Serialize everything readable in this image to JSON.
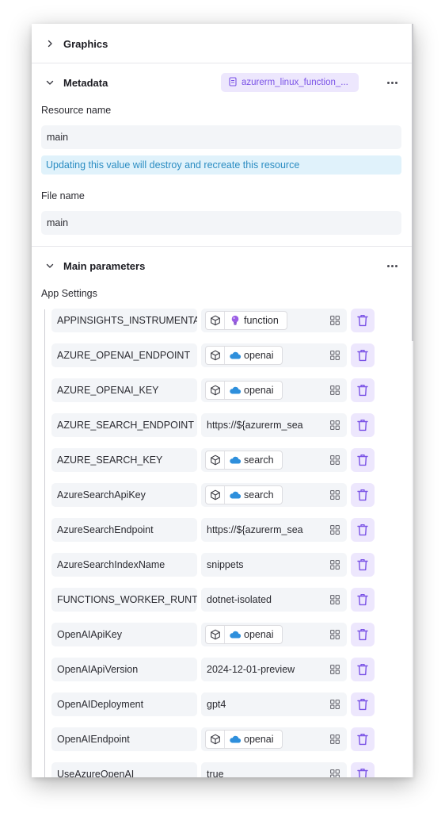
{
  "sections": {
    "graphics": {
      "title": "Graphics"
    },
    "metadata": {
      "title": "Metadata",
      "resource_badge": "azurerm_linux_function_...",
      "resource_name_label": "Resource name",
      "resource_name_value": "main",
      "info_message": "Updating this value will destroy and recreate this resource",
      "file_name_label": "File name",
      "file_name_value": "main"
    },
    "main_parameters": {
      "title": "Main parameters",
      "app_settings_label": "App Settings",
      "rows": [
        {
          "key": "APPINSIGHTS_INSTRUMENTAT",
          "type": "ref",
          "icon": "bulb-icon",
          "value": "function"
        },
        {
          "key": "AZURE_OPENAI_ENDPOINT",
          "type": "ref",
          "icon": "cloud-icon",
          "value": "openai"
        },
        {
          "key": "AZURE_OPENAI_KEY",
          "type": "ref",
          "icon": "cloud-icon",
          "value": "openai"
        },
        {
          "key": "AZURE_SEARCH_ENDPOINT",
          "type": "text",
          "value": "https://${azurerm_sea"
        },
        {
          "key": "AZURE_SEARCH_KEY",
          "type": "ref",
          "icon": "cloud-icon",
          "value": "search"
        },
        {
          "key": "AzureSearchApiKey",
          "type": "ref",
          "icon": "cloud-icon",
          "value": "search"
        },
        {
          "key": "AzureSearchEndpoint",
          "type": "text",
          "value": "https://${azurerm_sea"
        },
        {
          "key": "AzureSearchIndexName",
          "type": "text",
          "value": "snippets"
        },
        {
          "key": "FUNCTIONS_WORKER_RUNTIM",
          "type": "text",
          "value": "dotnet-isolated"
        },
        {
          "key": "OpenAIApiKey",
          "type": "ref",
          "icon": "cloud-icon",
          "value": "openai"
        },
        {
          "key": "OpenAIApiVersion",
          "type": "text",
          "value": "2024-12-01-preview"
        },
        {
          "key": "OpenAIDeployment",
          "type": "text",
          "value": "gpt4"
        },
        {
          "key": "OpenAIEndpoint",
          "type": "ref",
          "icon": "cloud-icon",
          "value": "openai"
        },
        {
          "key": "UseAzureOpenAI",
          "type": "text",
          "value": "true"
        }
      ]
    }
  },
  "colors": {
    "accent": "#7a52e6",
    "accent_bg": "#ede7fd",
    "info_text": "#2a8cc2",
    "info_bg": "#e0f2fb",
    "field_bg": "#f3f5f8",
    "cloud": "#2e8fdc",
    "bulb": "#9b5de5"
  }
}
